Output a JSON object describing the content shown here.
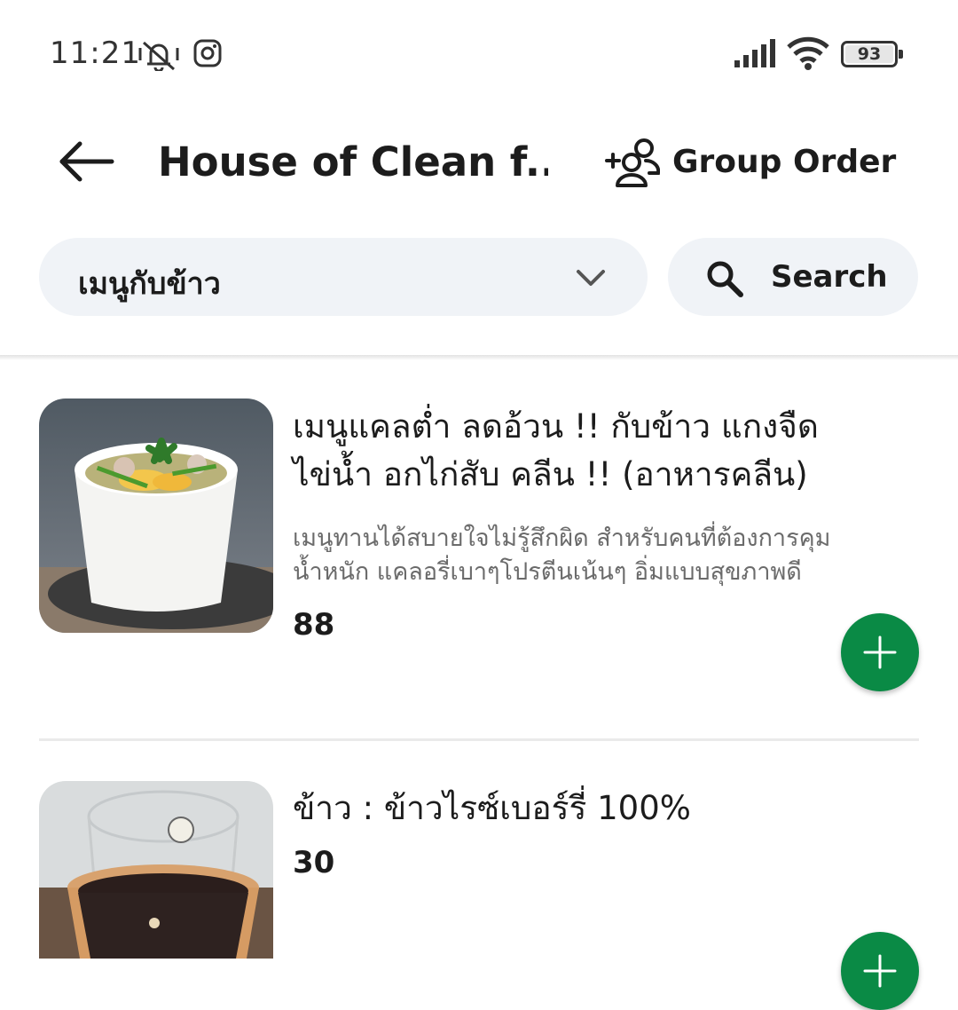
{
  "status_bar": {
    "time": "11:21",
    "battery": "93",
    "icons": [
      "vibrate-off-icon",
      "instagram-icon",
      "signal-icon",
      "wifi-icon",
      "battery-icon"
    ]
  },
  "header": {
    "back_icon": "arrow-left-icon",
    "title": "House of Clean f...",
    "group_order_icon": "add-people-icon",
    "group_order_label": "Group Order"
  },
  "filters": {
    "category_selected": "เมนูกับข้าว",
    "search_label": "Search"
  },
  "menu_items": [
    {
      "name_line1": "เมนูแคลต่ำ ลดอ้วน !! กับข้าว แกงจืด",
      "name_line2": "ไข่น้ำ อกไก่สับ คลีน !! (อาหารคลีน)",
      "desc_line1": "เมนูทานได้สบายใจไม่รู้สึกผิด สำหรับคนที่ต้องการคุม",
      "desc_line2": "น้ำหนัก  แคลอรี่เบาๆโปรตีนเน้นๆ อิ่มแบบสุขภาพดี",
      "price": "88"
    },
    {
      "name_line1": "ข้าว : ข้าวไรซ์เบอร์รี่ 100%",
      "price": "30"
    }
  ],
  "colors": {
    "accent_green": "#0a8a45",
    "pill_bg": "#f0f3f7"
  }
}
